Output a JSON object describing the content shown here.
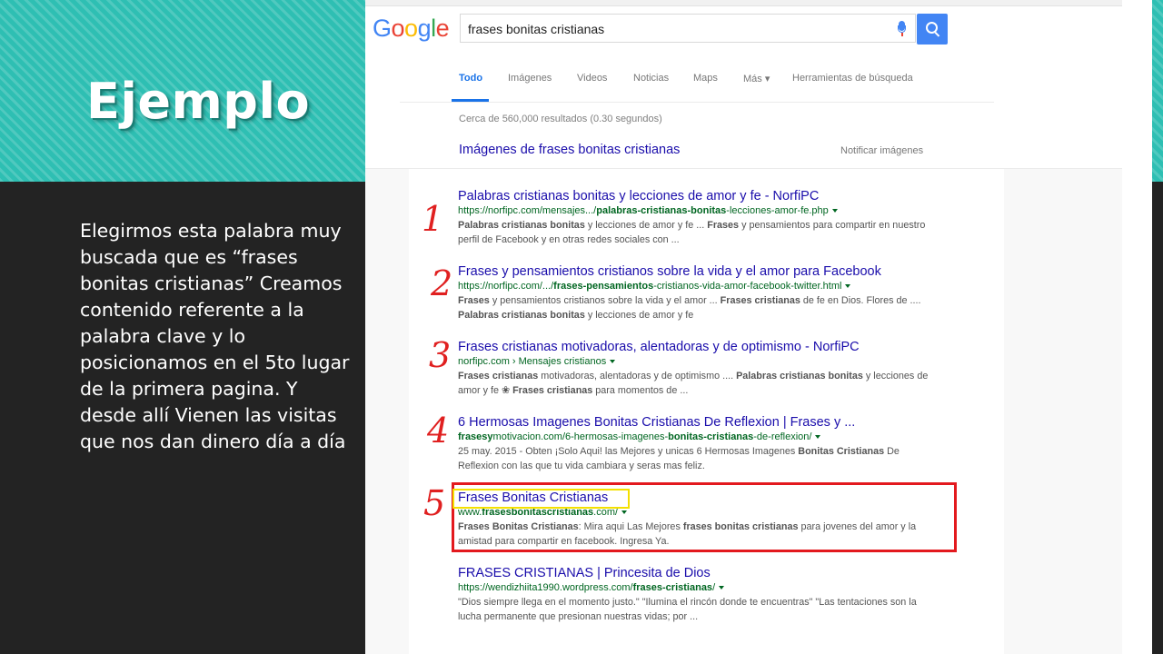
{
  "slide": {
    "title": "Ejemplo",
    "body": "Elegirmos esta palabra muy buscada que es “frases bonitas cristianas” Creamos contenido referente a la palabra clave y lo posicionamos en el 5to lugar de la primera pagina. Y desde allí Vienen las visitas que nos dan dinero día a día"
  },
  "colors": {
    "teal": "#2ebfb3",
    "dark": "#232323",
    "link": "#1a0dab",
    "url": "#006621",
    "highlight_red": "#e3191e",
    "highlight_yellow": "#f4e000"
  },
  "google": {
    "logo": [
      "G",
      "o",
      "o",
      "g",
      "l",
      "e"
    ],
    "logo_colors": [
      "#4285f4",
      "#ea4335",
      "#fbbc05",
      "#4285f4",
      "#34a853",
      "#ea4335"
    ],
    "query": "frases bonitas cristianas",
    "tabs": [
      "Todo",
      "Imágenes",
      "Videos",
      "Noticias",
      "Maps",
      "Más ▾",
      "Herramientas de búsqueda"
    ],
    "active_tab": "Todo",
    "stats": "Cerca de 560,000 resultados (0.30 segundos)",
    "images_link": "Imágenes de frases bonitas cristianas",
    "report_images": "Notificar imágenes",
    "results": [
      {
        "marker": "1",
        "title": "Palabras cristianas bonitas y lecciones de amor y fe - NorfiPC",
        "url": "https://norfipc.com/mensajes.../palabras-cristianas-bonitas-lecciones-amor-fe.php",
        "snippet": "Palabras cristianas bonitas y lecciones de amor y fe ... Frases y pensamientos para compartir en nuestro perfil de Facebook y en otras redes sociales con ..."
      },
      {
        "marker": "2",
        "title": "Frases y pensamientos cristianos sobre la vida y el amor para Facebook",
        "url": "https://norfipc.com/.../frases-pensamientos-cristianos-vida-amor-facebook-twitter.html",
        "snippet": "Frases y pensamientos cristianos sobre la vida y el amor ... Frases cristianas de fe en Dios. Flores de .... Palabras cristianas bonitas y lecciones de amor y fe"
      },
      {
        "marker": "3",
        "title": "Frases cristianas motivadoras, alentadoras y de optimismo - NorfiPC",
        "url": "norfipc.com › Mensajes cristianos",
        "snippet": "Frases cristianas motivadoras, alentadoras y de optimismo .... Palabras cristianas bonitas y lecciones de amor y fe ❀ Frases cristianas para momentos de ..."
      },
      {
        "marker": "4",
        "title": "6 Hermosas Imagenes Bonitas Cristianas De Reflexion | Frases y ...",
        "url": "frasesymotivacion.com/6-hermosas-imagenes-bonitas-cristianas-de-reflexion/",
        "snippet": "25 may. 2015 - Obten ¡Solo Aqui! las Mejores y unicas 6 Hermosas Imagenes Bonitas Cristianas De Reflexion con las que tu vida cambiara y seras mas feliz."
      },
      {
        "marker": "5",
        "title": "Frases Bonitas Cristianas",
        "url": "www.frasesbonitascristianas.com/",
        "snippet": "Frases Bonitas Cristianas: Mira aqui Las Mejores frases bonitas cristianas para jovenes del amor y la amistad para compartir en facebook. Ingresa Ya."
      },
      {
        "marker": "",
        "title": "FRASES CRISTIANAS | Princesita de Dios",
        "url": "https://wendizhiita1990.wordpress.com/frases-cristianas/",
        "snippet": "\"Dios siempre llega en el momento justo.\" \"Ilumina el rincón donde te encuentras\" \"Las tentaciones son la lucha permanente que presionan nuestras vidas; por ..."
      }
    ]
  }
}
